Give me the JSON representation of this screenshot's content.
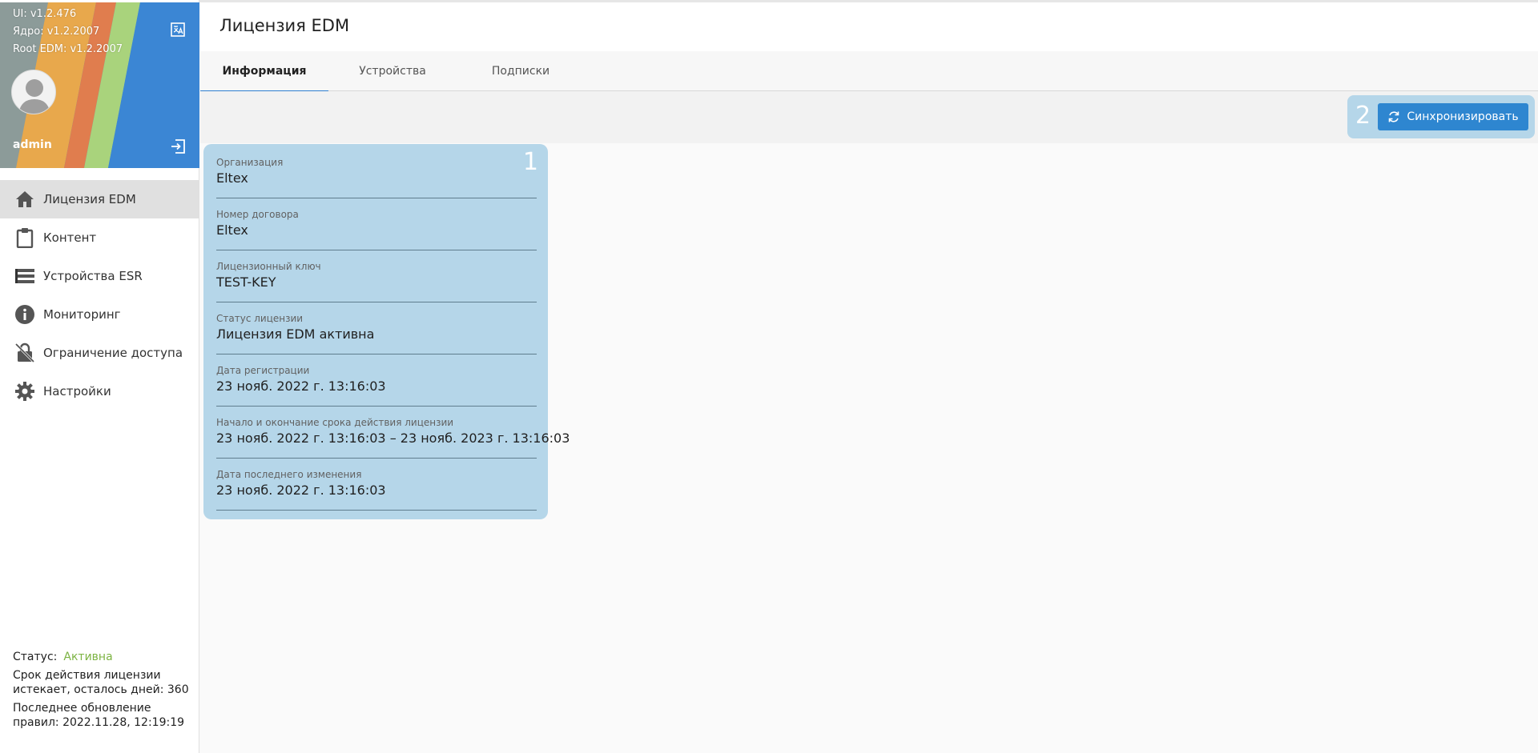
{
  "sidebar": {
    "versions": {
      "ui": "UI: v1.2.476",
      "core": "Ядро: v1.2.2007",
      "root": "Root EDM: v1.2.2007"
    },
    "username": "admin",
    "nav": [
      {
        "label": "Лицензия EDM",
        "icon": "home-icon",
        "active": true
      },
      {
        "label": "Контент",
        "icon": "clipboard-icon"
      },
      {
        "label": "Устройства ESR",
        "icon": "list-icon"
      },
      {
        "label": "Мониторинг",
        "icon": "info-icon"
      },
      {
        "label": "Ограничение доступа",
        "icon": "lock-off-icon"
      },
      {
        "label": "Настройки",
        "icon": "gear-icon"
      }
    ],
    "status": {
      "label": "Статус:",
      "value": "Активна",
      "license_line1": "Срок действия лицензии",
      "license_line2": "истекает, осталось дней: 360",
      "update_line1": "Последнее обновление",
      "update_line2": "правил: 2022.11.28, 12:19:19"
    }
  },
  "page": {
    "title": "Лицензия EDM",
    "tabs": [
      {
        "label": "Информация",
        "active": true
      },
      {
        "label": "Устройства"
      },
      {
        "label": "Подписки"
      }
    ],
    "sync_button": "Синхронизировать",
    "markers": {
      "card": "1",
      "toolbar": "2"
    }
  },
  "license_info": {
    "fields": [
      {
        "label": "Организация",
        "value": "Eltex"
      },
      {
        "label": "Номер договора",
        "value": "Eltex"
      },
      {
        "label": "Лицензионный ключ",
        "value": "TEST-KEY"
      },
      {
        "label": "Статус лицензии",
        "value": "Лицензия EDM активна"
      },
      {
        "label": "Дата регистрации",
        "value": "23 нояб. 2022 г. 13:16:03"
      },
      {
        "label": "Начало и окончание срока действия лицензии",
        "value": "23 нояб. 2022 г. 13:16:03 – 23 нояб. 2023 г. 13:16:03"
      },
      {
        "label": "Дата последнего изменения",
        "value": "23 нояб. 2022 г. 13:16:03"
      }
    ]
  },
  "colors": {
    "accent": "#2e86d0",
    "status_active": "#7cb342",
    "highlight": "#b5d6e9"
  }
}
